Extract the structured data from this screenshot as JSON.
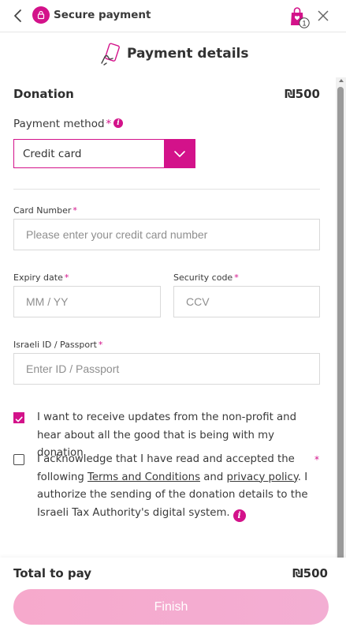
{
  "header": {
    "secure_label": "Secure payment",
    "cart_count": "1"
  },
  "title": "Payment details",
  "donation": {
    "label": "Donation",
    "amount": "₪500"
  },
  "payment_method": {
    "label": "Payment method",
    "required_mark": "*",
    "selected": "Credit card"
  },
  "card": {
    "number_label": "Card Number",
    "number_placeholder": "Please enter your credit card number",
    "expiry_label": "Expiry date",
    "expiry_placeholder": "MM / YY",
    "cvv_label": "Security code",
    "cvv_placeholder": "CCV",
    "id_label": "Israeli ID / Passport",
    "id_placeholder": "Enter ID / Passport",
    "required_mark": "*"
  },
  "consents": {
    "updates_text": "I want to receive updates from the non-profit and hear about all the good that is being with my donation",
    "updates_checked": true,
    "terms_pre": "I acknowledge that I have read and accepted the following ",
    "terms_link": "Terms and Conditions",
    "terms_mid": " and ",
    "privacy_link": "privacy policy",
    "terms_post": ". I authorize the sending of the donation details to the Israeli Tax Authority's digital system.",
    "terms_checked": false,
    "required_mark": "*"
  },
  "footer": {
    "total_label": "Total to pay",
    "total_amount": "₪500",
    "finish_label": "Finish"
  },
  "colors": {
    "accent": "#d3128a",
    "button": "#f6a9cc"
  }
}
